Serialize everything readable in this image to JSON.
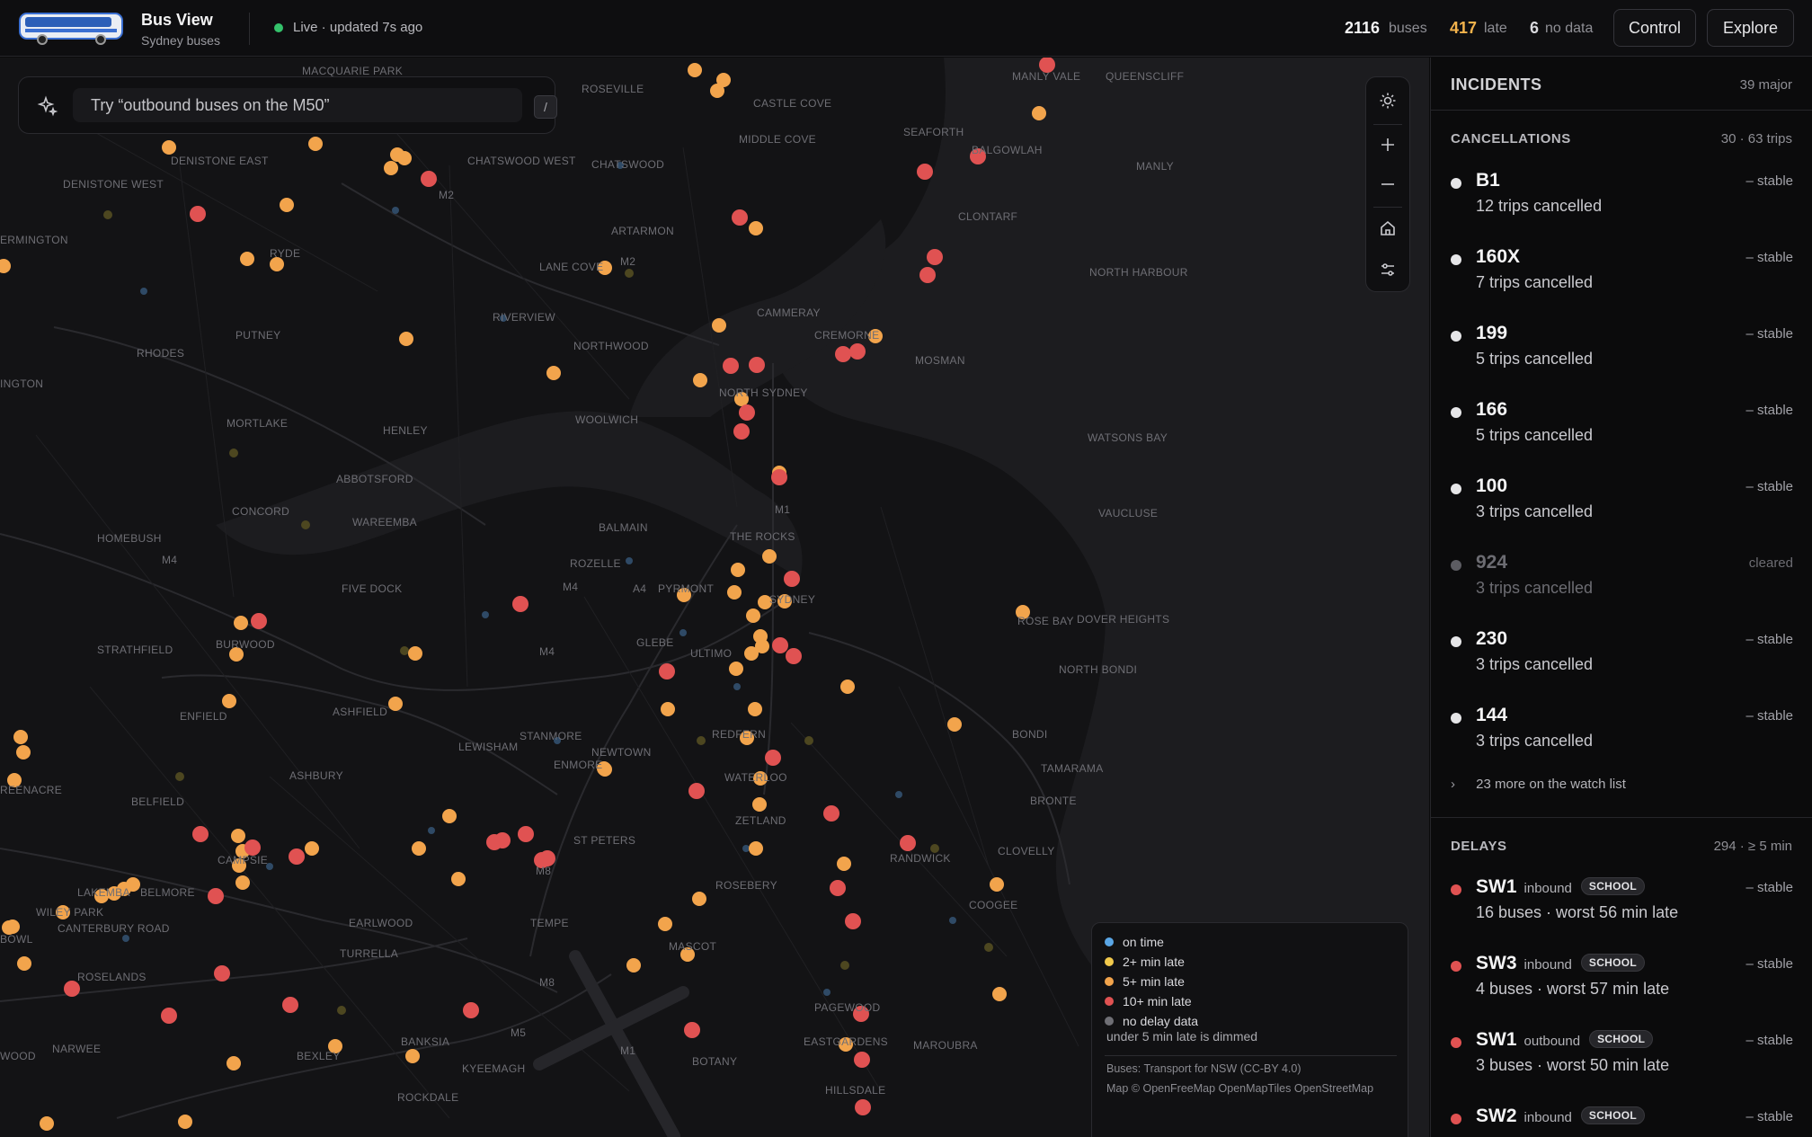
{
  "header": {
    "app_title": "Bus View",
    "app_subtitle": "Sydney buses",
    "live_text": "Live · updated 7s ago",
    "buses_count": "2116",
    "buses_label": "buses",
    "late_count": "417",
    "late_label": "late",
    "nodata_count": "6",
    "nodata_label": "no data",
    "control_label": "Control",
    "explore_label": "Explore",
    "late_color": "#f3b34c"
  },
  "search": {
    "placeholder": "Try “outbound buses on the M50”",
    "shortcut": "/"
  },
  "map": {
    "places": [
      "MACQUARIE PARK",
      "ROSEVILLE",
      "CASTLE COVE",
      "MANLY VALE",
      "QUEENSCLIFF",
      "DENISTONE EAST",
      "CHATSWOOD WEST",
      "CHATSWOOD",
      "MIDDLE COVE",
      "SEAFORTH",
      "BALGOWLAH",
      "MANLY",
      "DENISTONE WEST",
      "M2",
      "CLONTARF",
      "ERMINGTON",
      "RYDE",
      "ARTARMON",
      "LANE COVE",
      "M2",
      "NORTH HARBOUR",
      "CAMMERAY",
      "RIVERVIEW",
      "PUTNEY",
      "CREMORNE",
      "NORTHWOOD",
      "MOSMAN",
      "RHODES",
      "NORTH SYDNEY",
      "INGTON",
      "MORTLAKE",
      "WOOLWICH",
      "HENLEY",
      "WATSONS BAY",
      "ABBOTSFORD",
      "M1",
      "CONCORD",
      "WAREEMBA",
      "VAUCLUSE",
      "BALMAIN",
      "THE ROCKS",
      "HOMEBUSH",
      "M4",
      "ROZELLE",
      "FIVE DOCK",
      "M4",
      "A4",
      "PYRMONT",
      "SYDNEY",
      "ROSE BAY",
      "DOVER HEIGHTS",
      "BURWOOD",
      "STRATHFIELD",
      "GLEBE",
      "ULTIMO",
      "M4",
      "NORTH BONDI",
      "ENFIELD",
      "ASHFIELD",
      "STANMORE",
      "REDFERN",
      "BONDI",
      "LEWISHAM",
      "NEWTOWN",
      "ENMORE",
      "TAMARAMA",
      "ASHBURY",
      "WATERLOO",
      "BELFIELD",
      "BRONTE",
      "ST PETERS",
      "ZETLAND",
      "CLOVELLY",
      "CAMPSIE",
      "RANDWICK",
      "LAKEMBA",
      "BELMORE",
      "ROSEBERY",
      "WILEY PARK",
      "M8",
      "TEMPE",
      "COOGEE",
      "EARLWOOD",
      "TURRELLA",
      "MASCOT",
      "ROSELANDS",
      "M8",
      "PAGEWOOD",
      "BANKSIA",
      "M5",
      "EASTGARDENS",
      "MAROUBRA",
      "NARWEE",
      "M1",
      "BOTANY",
      "BEXLEY",
      "KYEEMAGH",
      "HILLSDALE",
      "ROCKDALE",
      "CANTERBURY ROAD",
      "REENACRE",
      "BOWL",
      "WOOD"
    ]
  },
  "legend": {
    "items": [
      {
        "label": "on time",
        "color": "#5aa6e6"
      },
      {
        "label": "2+ min late",
        "color": "#f2c94c"
      },
      {
        "label": "5+ min late",
        "color": "#f2a44c"
      },
      {
        "label": "10+ min late",
        "color": "#e05252"
      },
      {
        "label": "no delay data",
        "color": "#6f6f75"
      }
    ],
    "note": "under 5 min late is dimmed",
    "credit_buses": "Buses: Transport for NSW (CC-BY 4.0)",
    "credit_map": "Map © OpenFreeMap OpenMapTiles OpenStreetMap"
  },
  "panel": {
    "title": "INCIDENTS",
    "count": "39 major",
    "cancellations": {
      "title": "CANCELLATIONS",
      "count": "30 · 63 trips",
      "items": [
        {
          "name": "B1",
          "desc": "12 trips cancelled",
          "status": "– stable"
        },
        {
          "name": "160X",
          "desc": "7 trips cancelled",
          "status": "– stable"
        },
        {
          "name": "199",
          "desc": "5 trips cancelled",
          "status": "– stable"
        },
        {
          "name": "166",
          "desc": "5 trips cancelled",
          "status": "– stable"
        },
        {
          "name": "100",
          "desc": "3 trips cancelled",
          "status": "– stable"
        },
        {
          "name": "924",
          "desc": "3 trips cancelled",
          "status": "cleared"
        },
        {
          "name": "230",
          "desc": "3 trips cancelled",
          "status": "– stable"
        },
        {
          "name": "144",
          "desc": "3 trips cancelled",
          "status": "– stable"
        }
      ],
      "more": "23 more on the watch list"
    },
    "delays": {
      "title": "DELAYS",
      "count": "294 · ≥ 5 min",
      "items": [
        {
          "name": "SW1",
          "direction": "inbound",
          "badge": "SCHOOL",
          "desc": "16 buses · worst 56 min late",
          "status": "– stable"
        },
        {
          "name": "SW3",
          "direction": "inbound",
          "badge": "SCHOOL",
          "desc": "4 buses · worst 57 min late",
          "status": "– stable"
        },
        {
          "name": "SW1",
          "direction": "outbound",
          "badge": "SCHOOL",
          "desc": "3 buses · worst 50 min late",
          "status": "– stable"
        },
        {
          "name": "SW2",
          "direction": "inbound",
          "badge": "SCHOOL",
          "desc": "",
          "status": "– stable"
        }
      ]
    }
  }
}
